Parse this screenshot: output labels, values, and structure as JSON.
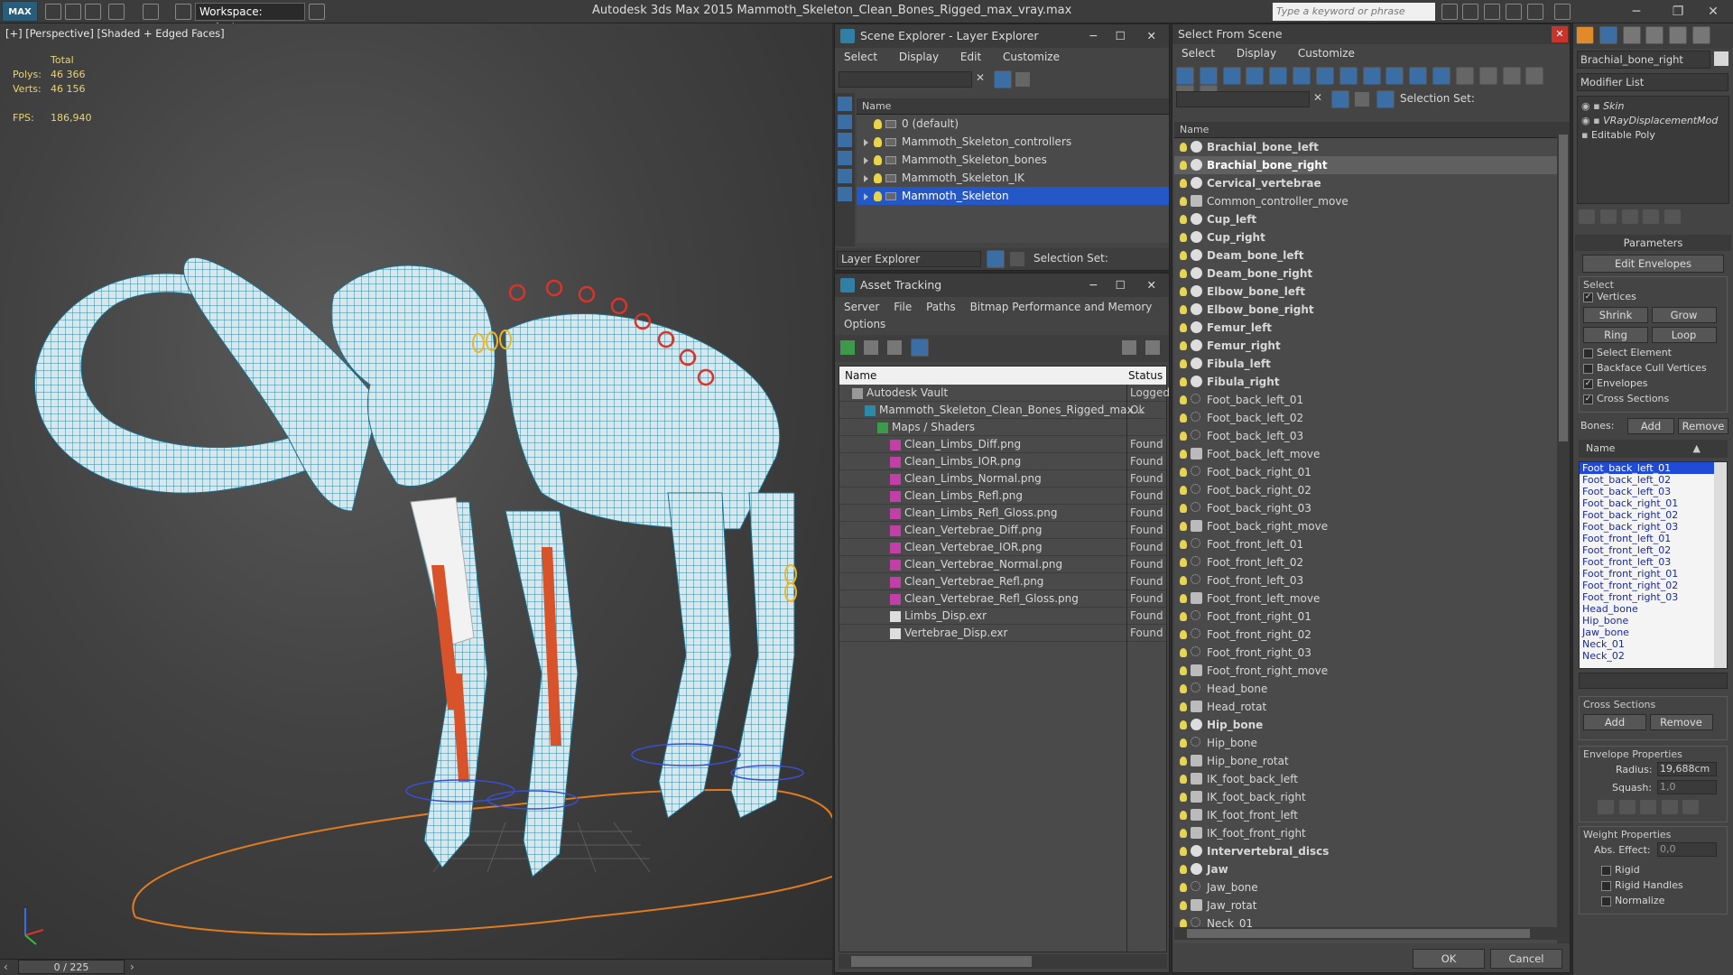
{
  "titlebar": {
    "logo": "MAX",
    "workspace": "Workspace: Default",
    "app_title": "Autodesk 3ds Max  2015     Mammoth_Skeleton_Clean_Bones_Rigged_max_vray.max",
    "search_placeholder": "Type a keyword or phrase"
  },
  "viewport": {
    "label": "[+] [Perspective] [Shaded + Edged Faces]",
    "stats_total": "Total",
    "polys_label": "Polys:",
    "polys_value": "46 366",
    "verts_label": "Verts:",
    "verts_value": "46 156",
    "fps_label": "FPS:",
    "fps_value": "186,940"
  },
  "timeline": {
    "frame": "0 / 225"
  },
  "scene_explorer": {
    "title": "Scene Explorer - Layer Explorer",
    "menu": [
      "Select",
      "Display",
      "Edit",
      "Customize"
    ],
    "column": "Name",
    "layers": [
      {
        "name": "0 (default)",
        "expandable": false,
        "selected": false
      },
      {
        "name": "Mammoth_Skeleton_controllers",
        "expandable": true,
        "selected": false
      },
      {
        "name": "Mammoth_Skeleton_bones",
        "expandable": true,
        "selected": false
      },
      {
        "name": "Mammoth_Skeleton_IK",
        "expandable": true,
        "selected": false
      },
      {
        "name": "Mammoth_Skeleton",
        "expandable": true,
        "selected": true
      }
    ],
    "footer_dropdown": "Layer Explorer",
    "selection_set": "Selection Set:"
  },
  "asset_tracking": {
    "title": "Asset Tracking",
    "menu": [
      "Server",
      "File",
      "Paths",
      "Bitmap Performance and Memory",
      "Options"
    ],
    "col_name": "Name",
    "col_status": "Status",
    "rows": [
      {
        "name": "Autodesk Vault",
        "status": "Logged",
        "indent": 1,
        "icon": "vault"
      },
      {
        "name": "Mammoth_Skeleton_Clean_Bones_Rigged_max...",
        "status": "Ok",
        "indent": 2,
        "icon": "max"
      },
      {
        "name": "Maps / Shaders",
        "status": "",
        "indent": 3,
        "icon": "maps"
      },
      {
        "name": "Clean_Limbs_Diff.png",
        "status": "Found",
        "indent": 4,
        "icon": "png"
      },
      {
        "name": "Clean_Limbs_IOR.png",
        "status": "Found",
        "indent": 4,
        "icon": "png"
      },
      {
        "name": "Clean_Limbs_Normal.png",
        "status": "Found",
        "indent": 4,
        "icon": "png"
      },
      {
        "name": "Clean_Limbs_Refl.png",
        "status": "Found",
        "indent": 4,
        "icon": "png"
      },
      {
        "name": "Clean_Limbs_Refl_Gloss.png",
        "status": "Found",
        "indent": 4,
        "icon": "png"
      },
      {
        "name": "Clean_Vertebrae_Diff.png",
        "status": "Found",
        "indent": 4,
        "icon": "png"
      },
      {
        "name": "Clean_Vertebrae_IOR.png",
        "status": "Found",
        "indent": 4,
        "icon": "png"
      },
      {
        "name": "Clean_Vertebrae_Normal.png",
        "status": "Found",
        "indent": 4,
        "icon": "png"
      },
      {
        "name": "Clean_Vertebrae_Refl.png",
        "status": "Found",
        "indent": 4,
        "icon": "png"
      },
      {
        "name": "Clean_Vertebrae_Refl_Gloss.png",
        "status": "Found",
        "indent": 4,
        "icon": "png"
      },
      {
        "name": "Limbs_Disp.exr",
        "status": "Found",
        "indent": 4,
        "icon": "exr"
      },
      {
        "name": "Vertebrae_Disp.exr",
        "status": "Found",
        "indent": 4,
        "icon": "exr"
      }
    ]
  },
  "select_from_scene": {
    "title": "Select From Scene",
    "menu": [
      "Select",
      "Display",
      "Customize"
    ],
    "selection_set": "Selection Set:",
    "column": "Name",
    "ok": "OK",
    "cancel": "Cancel",
    "items": [
      {
        "name": "Brachial_bone_left",
        "bold": true,
        "kind": "ball"
      },
      {
        "name": "Brachial_bone_right",
        "bold": true,
        "kind": "ball",
        "hl": true
      },
      {
        "name": "Cervical_vertebrae",
        "bold": true,
        "kind": "ball"
      },
      {
        "name": "Common_controller_move",
        "bold": false,
        "kind": "sq"
      },
      {
        "name": "Cup_left",
        "bold": true,
        "kind": "ball"
      },
      {
        "name": "Cup_right",
        "bold": true,
        "kind": "ball"
      },
      {
        "name": "Deam_bone_left",
        "bold": true,
        "kind": "ball"
      },
      {
        "name": "Deam_bone_right",
        "bold": true,
        "kind": "ball"
      },
      {
        "name": "Elbow_bone_left",
        "bold": true,
        "kind": "ball"
      },
      {
        "name": "Elbow_bone_right",
        "bold": true,
        "kind": "ball"
      },
      {
        "name": "Femur_left",
        "bold": true,
        "kind": "ball"
      },
      {
        "name": "Femur_right",
        "bold": true,
        "kind": "ball"
      },
      {
        "name": "Fibula_left",
        "bold": true,
        "kind": "ball"
      },
      {
        "name": "Fibula_right",
        "bold": true,
        "kind": "ball"
      },
      {
        "name": "Foot_back_left_01",
        "bold": false,
        "kind": "dot"
      },
      {
        "name": "Foot_back_left_02",
        "bold": false,
        "kind": "dot"
      },
      {
        "name": "Foot_back_left_03",
        "bold": false,
        "kind": "dot"
      },
      {
        "name": "Foot_back_left_move",
        "bold": false,
        "kind": "sq"
      },
      {
        "name": "Foot_back_right_01",
        "bold": false,
        "kind": "dot"
      },
      {
        "name": "Foot_back_right_02",
        "bold": false,
        "kind": "dot"
      },
      {
        "name": "Foot_back_right_03",
        "bold": false,
        "kind": "dot"
      },
      {
        "name": "Foot_back_right_move",
        "bold": false,
        "kind": "sq"
      },
      {
        "name": "Foot_front_left_01",
        "bold": false,
        "kind": "dot"
      },
      {
        "name": "Foot_front_left_02",
        "bold": false,
        "kind": "dot"
      },
      {
        "name": "Foot_front_left_03",
        "bold": false,
        "kind": "dot"
      },
      {
        "name": "Foot_front_left_move",
        "bold": false,
        "kind": "sq"
      },
      {
        "name": "Foot_front_right_01",
        "bold": false,
        "kind": "dot"
      },
      {
        "name": "Foot_front_right_02",
        "bold": false,
        "kind": "dot"
      },
      {
        "name": "Foot_front_right_03",
        "bold": false,
        "kind": "dot"
      },
      {
        "name": "Foot_front_right_move",
        "bold": false,
        "kind": "sq"
      },
      {
        "name": "Head_bone",
        "bold": false,
        "kind": "dot"
      },
      {
        "name": "Head_rotat",
        "bold": false,
        "kind": "sq"
      },
      {
        "name": "Hip_bone",
        "bold": true,
        "kind": "ball"
      },
      {
        "name": "Hip_bone",
        "bold": false,
        "kind": "dot"
      },
      {
        "name": "Hip_bone_rotat",
        "bold": false,
        "kind": "sq"
      },
      {
        "name": "IK_foot_back_left",
        "bold": false,
        "kind": "sq"
      },
      {
        "name": "IK_foot_back_right",
        "bold": false,
        "kind": "sq"
      },
      {
        "name": "IK_foot_front_left",
        "bold": false,
        "kind": "sq"
      },
      {
        "name": "IK_foot_front_right",
        "bold": false,
        "kind": "sq"
      },
      {
        "name": "Intervertebral_discs",
        "bold": true,
        "kind": "ball"
      },
      {
        "name": "Jaw",
        "bold": true,
        "kind": "ball"
      },
      {
        "name": "Jaw_bone",
        "bold": false,
        "kind": "dot"
      },
      {
        "name": "Jaw_rotat",
        "bold": false,
        "kind": "sq"
      },
      {
        "name": "Neck_01",
        "bold": false,
        "kind": "dot"
      }
    ]
  },
  "command_panel": {
    "object_name": "Brachial_bone_right",
    "modifier_list": "Modifier List",
    "stack": [
      "Skin",
      "VRayDisplacementMod",
      "Editable Poly"
    ],
    "parameters": "Parameters",
    "edit_envelopes": "Edit Envelopes",
    "select_label": "Select",
    "vertices": "Vertices",
    "shrink": "Shrink",
    "grow": "Grow",
    "ring": "Ring",
    "loop": "Loop",
    "select_element": "Select Element",
    "backface_cull": "Backface Cull Vertices",
    "envelopes": "Envelopes",
    "cross_sections": "Cross Sections",
    "bones_label": "Bones:",
    "add": "Add",
    "remove": "Remove",
    "name_col": "Name",
    "bones": [
      "Foot_back_left_01",
      "Foot_back_left_02",
      "Foot_back_left_03",
      "Foot_back_right_01",
      "Foot_back_right_02",
      "Foot_back_right_03",
      "Foot_front_left_01",
      "Foot_front_left_02",
      "Foot_front_left_03",
      "Foot_front_right_01",
      "Foot_front_right_02",
      "Foot_front_right_03",
      "Head_bone",
      "Hip_bone",
      "Jaw_bone",
      "Neck_01",
      "Neck_02"
    ],
    "cross_sections_group": "Cross Sections",
    "cs_add": "Add",
    "cs_remove": "Remove",
    "envelope_props": "Envelope Properties",
    "radius_label": "Radius:",
    "radius_value": "19,688cm",
    "squash_label": "Squash:",
    "squash_value": "1,0",
    "weight_props": "Weight Properties",
    "abs_effect_label": "Abs. Effect:",
    "abs_effect_value": "0,0",
    "rigid": "Rigid",
    "rigid_handles": "Rigid Handles",
    "normalize": "Normalize"
  }
}
